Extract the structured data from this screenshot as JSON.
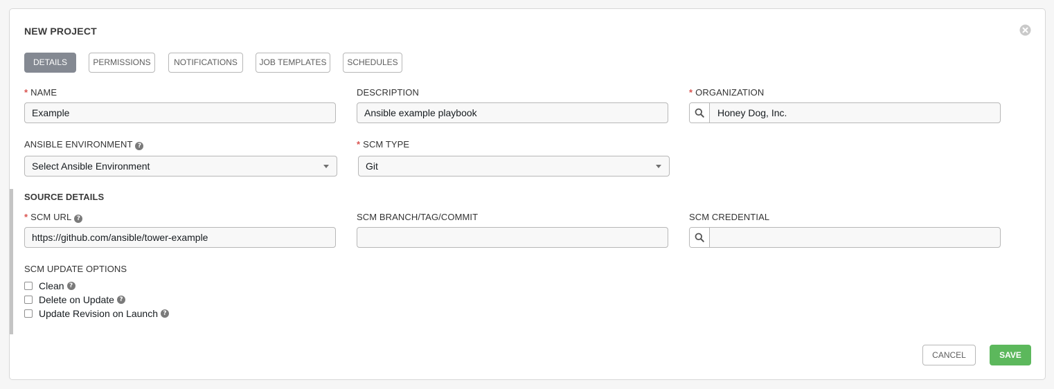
{
  "form": {
    "title": "NEW PROJECT",
    "close_icon": "close-circle-icon"
  },
  "tabs": [
    {
      "label": "DETAILS",
      "active": true
    },
    {
      "label": "PERMISSIONS",
      "active": false
    },
    {
      "label": "NOTIFICATIONS",
      "active": false
    },
    {
      "label": "JOB TEMPLATES",
      "active": false
    },
    {
      "label": "SCHEDULES",
      "active": false
    }
  ],
  "fields": {
    "name": {
      "label": "NAME",
      "required": true,
      "value": "Example"
    },
    "description": {
      "label": "DESCRIPTION",
      "required": false,
      "value": "Ansible example playbook"
    },
    "organization": {
      "label": "ORGANIZATION",
      "required": true,
      "value": "Honey Dog, Inc."
    },
    "ansible_environment": {
      "label": "ANSIBLE ENVIRONMENT",
      "required": false,
      "value": "Select Ansible Environment"
    },
    "scm_type": {
      "label": "SCM TYPE",
      "required": true,
      "value": "Git"
    }
  },
  "source_details": {
    "heading": "SOURCE DETAILS",
    "scm_url": {
      "label": "SCM URL",
      "required": true,
      "value": "https://github.com/ansible/tower-example"
    },
    "scm_branch": {
      "label": "SCM BRANCH/TAG/COMMIT",
      "value": ""
    },
    "scm_credential": {
      "label": "SCM CREDENTIAL",
      "value": ""
    },
    "update_options": {
      "heading": "SCM UPDATE OPTIONS",
      "options": [
        {
          "label": "Clean",
          "checked": false
        },
        {
          "label": "Delete on Update",
          "checked": false
        },
        {
          "label": "Update Revision on Launch",
          "checked": false
        }
      ]
    }
  },
  "actions": {
    "cancel_label": "CANCEL",
    "save_label": "SAVE"
  },
  "colors": {
    "accent_active_tab": "#848992",
    "required_star": "#d9534f",
    "save_button": "#5cb85c"
  },
  "help_glyph": "?"
}
